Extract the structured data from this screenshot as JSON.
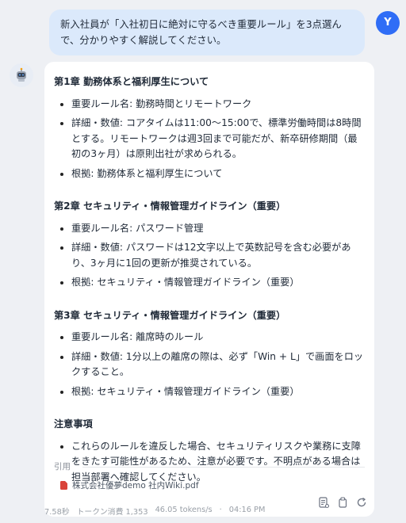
{
  "user": {
    "avatar_letter": "Y",
    "message": "新入社員が「入社初日に絶対に守るべき重要ルール」を3点選んで、分かりやすく解説してください。"
  },
  "answer": {
    "sections": [
      {
        "title": "第1章 勤務体系と福利厚生について",
        "items": [
          "重要ルール名: 勤務時間とリモートワーク",
          "詳細・数値: コアタイムは11:00〜15:00で、標準労働時間は8時間とする。リモートワークは週3回まで可能だが、新卒研修期間（最初の3ヶ月）は原則出社が求められる。",
          "根拠: 勤務体系と福利厚生について"
        ]
      },
      {
        "title": "第2章 セキュリティ・情報管理ガイドライン（重要）",
        "items": [
          "重要ルール名: パスワード管理",
          "詳細・数値: パスワードは12文字以上で英数記号を含む必要があり、3ヶ月に1回の更新が推奨されている。",
          "根拠: セキュリティ・情報管理ガイドライン（重要）"
        ]
      },
      {
        "title": "第3章 セキュリティ・情報管理ガイドライン（重要）",
        "items": [
          "重要ルール名: 離席時のルール",
          "詳細・数値: 1分以上の離席の際は、必ず「Win + L」で画面をロックすること。",
          "根拠: セキュリティ・情報管理ガイドライン（重要）"
        ]
      },
      {
        "title": "注意事項",
        "items": [
          "これらのルールを違反した場合、セキュリティリスクや業務に支障をきたす可能性があるため、注意が必要です。不明点がある場合は担当部署へ確認してください。"
        ]
      }
    ],
    "citation_label": "引用",
    "citation_file": "株式会社優夢demo 社内Wiki.pdf"
  },
  "footer": {
    "elapsed": "7.58秒",
    "tokens": "トークン消費 1,353",
    "speed": "46.05 tokens/s",
    "separator": "·",
    "time": "04:16 PM"
  },
  "icons": {
    "bot_avatar": "robot-icon",
    "citation": "pdf-file-icon",
    "actions": [
      "summary-icon",
      "copy-icon",
      "regenerate-icon"
    ]
  }
}
